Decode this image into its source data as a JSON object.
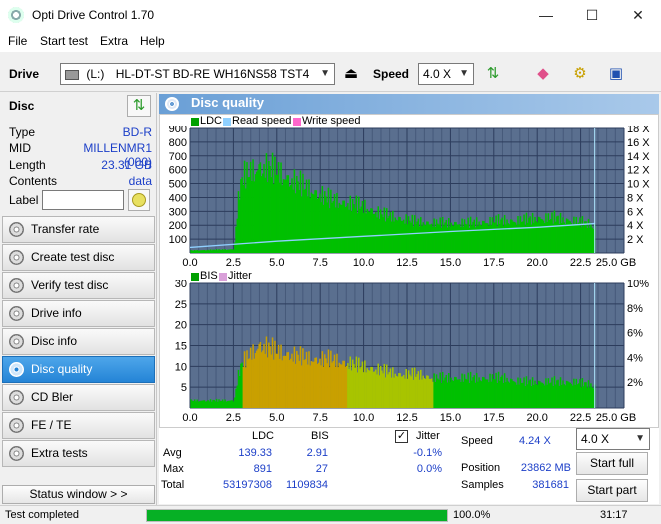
{
  "window": {
    "title": "Opti Drive Control 1.70",
    "minimize": "—",
    "maximize": "☐",
    "close": "✕"
  },
  "menu": [
    "File",
    "Start test",
    "Extra",
    "Help"
  ],
  "toolbar": {
    "drive_label": "Drive",
    "drive_letter": "(L:)",
    "drive_value": "HL-DT-ST BD-RE  WH16NS58 TST4",
    "speed_label": "Speed",
    "speed_value": "4.0 X"
  },
  "disc": {
    "header": "Disc",
    "type_label": "Type",
    "type_value": "BD-R",
    "mid_label": "MID",
    "mid_value": "MILLENMR1 (000)",
    "length_label": "Length",
    "length_value": "23.31 GB",
    "contents_label": "Contents",
    "contents_value": "data",
    "label_label": "Label",
    "label_value": ""
  },
  "nav": [
    "Transfer rate",
    "Create test disc",
    "Verify test disc",
    "Drive info",
    "Disc info",
    "Disc quality",
    "CD Bler",
    "FE / TE",
    "Extra tests"
  ],
  "status_window_btn": "Status window > >",
  "main_title": "Disc quality",
  "legend_top": {
    "ldc": "LDC",
    "read": "Read speed",
    "write": "Write speed"
  },
  "legend_bottom": {
    "bis": "BIS",
    "jitter": "Jitter"
  },
  "colors": {
    "ldc": "#00c000",
    "read": "#8fd0ff",
    "write": "#ff66cc",
    "bis": "#00c000",
    "jitter": "#d9a0d9",
    "bg": "#5a6f8f",
    "grid": "#1a2a4a"
  },
  "chart_data": [
    {
      "type": "area",
      "title": "LDC",
      "xlim": [
        0,
        25
      ],
      "x_ticks": [
        "0.0",
        "2.5",
        "5.0",
        "7.5",
        "10.0",
        "12.5",
        "15.0",
        "17.5",
        "20.0",
        "22.5",
        "25.0 GB"
      ],
      "y_ticks_left": [
        "900",
        "800",
        "700",
        "600",
        "500",
        "400",
        "300",
        "200",
        "100"
      ],
      "y_ticks_right": [
        "18 X",
        "16 X",
        "14 X",
        "12 X",
        "10 X",
        "8 X",
        "6 X",
        "4 X",
        "2 X"
      ],
      "ylim": [
        0,
        900
      ],
      "series": [
        {
          "name": "LDC",
          "x": [
            0,
            2.5,
            2.8,
            3,
            4,
            5,
            6,
            7,
            8,
            9,
            10,
            11,
            12,
            13,
            14,
            15,
            16,
            17,
            18,
            19,
            20,
            21,
            22,
            23.31
          ],
          "values": [
            20,
            30,
            500,
            600,
            700,
            650,
            570,
            500,
            430,
            400,
            370,
            310,
            280,
            250,
            240,
            240,
            240,
            250,
            260,
            260,
            280,
            280,
            260,
            220
          ]
        },
        {
          "name": "Read speed",
          "x": [
            0,
            5,
            10,
            15,
            20,
            23.31
          ],
          "values": [
            0.8,
            1.7,
            2.4,
            3.1,
            3.7,
            4.24
          ]
        }
      ]
    },
    {
      "type": "area",
      "title": "BIS",
      "xlim": [
        0,
        25
      ],
      "x_ticks": [
        "0.0",
        "2.5",
        "5.0",
        "7.5",
        "10.0",
        "12.5",
        "15.0",
        "17.5",
        "20.0",
        "22.5",
        "25.0 GB"
      ],
      "y_ticks_left": [
        "30",
        "25",
        "20",
        "15",
        "10",
        "5"
      ],
      "y_ticks_right": [
        "10%",
        "8%",
        "6%",
        "4%",
        "2%"
      ],
      "ylim": [
        0,
        30
      ],
      "series": [
        {
          "name": "BIS",
          "x": [
            0,
            2.5,
            2.8,
            3,
            4,
            5,
            6,
            7,
            8,
            9,
            10,
            11,
            12,
            13,
            14,
            15,
            16,
            17,
            18,
            19,
            20,
            21,
            22,
            23.31
          ],
          "values": [
            2,
            2,
            10,
            12,
            17,
            15,
            14,
            13,
            13,
            12,
            11,
            10,
            9,
            9,
            8,
            8,
            8,
            8,
            8,
            7,
            7,
            7,
            7,
            6
          ]
        }
      ]
    }
  ],
  "stats": {
    "headers": [
      "LDC",
      "BIS"
    ],
    "jitter_label": "Jitter",
    "avg_label": "Avg",
    "avg_ldc": "139.33",
    "avg_bis": "2.91",
    "avg_jitter": "-0.1%",
    "max_label": "Max",
    "max_ldc": "891",
    "max_bis": "27",
    "max_jitter": "0.0%",
    "total_label": "Total",
    "total_ldc": "53197308",
    "total_bis": "1109834",
    "speed_label": "Speed",
    "speed_value": "4.24 X",
    "speed_select": "4.0 X",
    "position_label": "Position",
    "position_value": "23862 MB",
    "samples_label": "Samples",
    "samples_value": "381681",
    "start_full": "Start full",
    "start_part": "Start part"
  },
  "status": {
    "text": "Test completed",
    "progress": "100.0%",
    "progress_fraction": 1.0,
    "time": "31:17"
  }
}
